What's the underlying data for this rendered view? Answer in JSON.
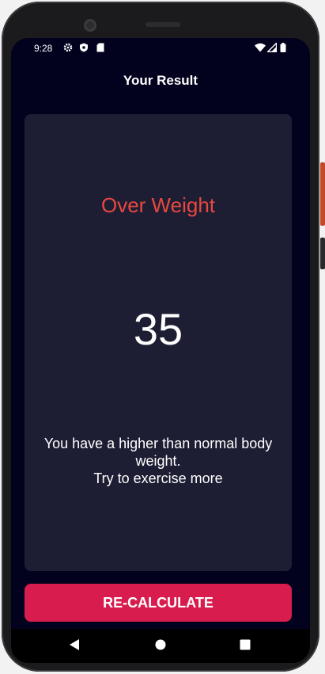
{
  "status_bar": {
    "time": "9:28",
    "left_icons": [
      "gear-icon",
      "shield-icon",
      "sd-card-icon"
    ],
    "right_icons": [
      "wifi-icon",
      "signal-icon",
      "battery-icon"
    ]
  },
  "header": {
    "title": "Your Result"
  },
  "result": {
    "status": "Over Weight",
    "value": "35",
    "advice": "You have a higher than normal body weight.\nTry to exercise more",
    "status_color": "#e8483f"
  },
  "actions": {
    "recalculate_label": "RE-CALCULATE",
    "button_color": "#d81c4e"
  },
  "nav_bar": {
    "buttons": [
      "back-icon",
      "home-icon",
      "recents-icon"
    ]
  },
  "theme": {
    "background": "#03021e",
    "card": "#1d1e33"
  }
}
